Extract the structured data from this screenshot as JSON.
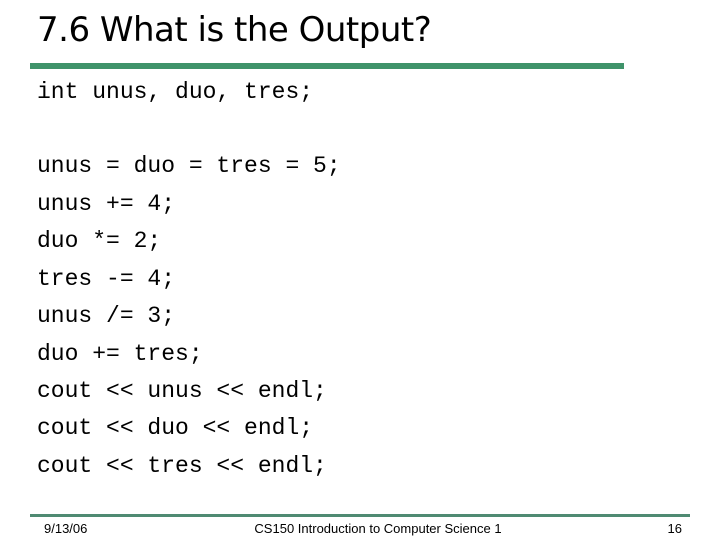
{
  "slide": {
    "title": "7.6 What is the Output?",
    "accent_color": "#3f936a",
    "code_lines": [
      "int unus, duo, tres;",
      "unus = duo = tres = 5;",
      "unus += 4;",
      "duo *= 2;",
      "tres -= 4;",
      "unus /= 3;",
      "duo += tres;",
      "cout << unus << endl;",
      "cout << duo << endl;",
      "cout << tres << endl;"
    ]
  },
  "footer": {
    "date": "9/13/06",
    "course": "CS150 Introduction to Computer Science 1",
    "page_number": "16"
  }
}
